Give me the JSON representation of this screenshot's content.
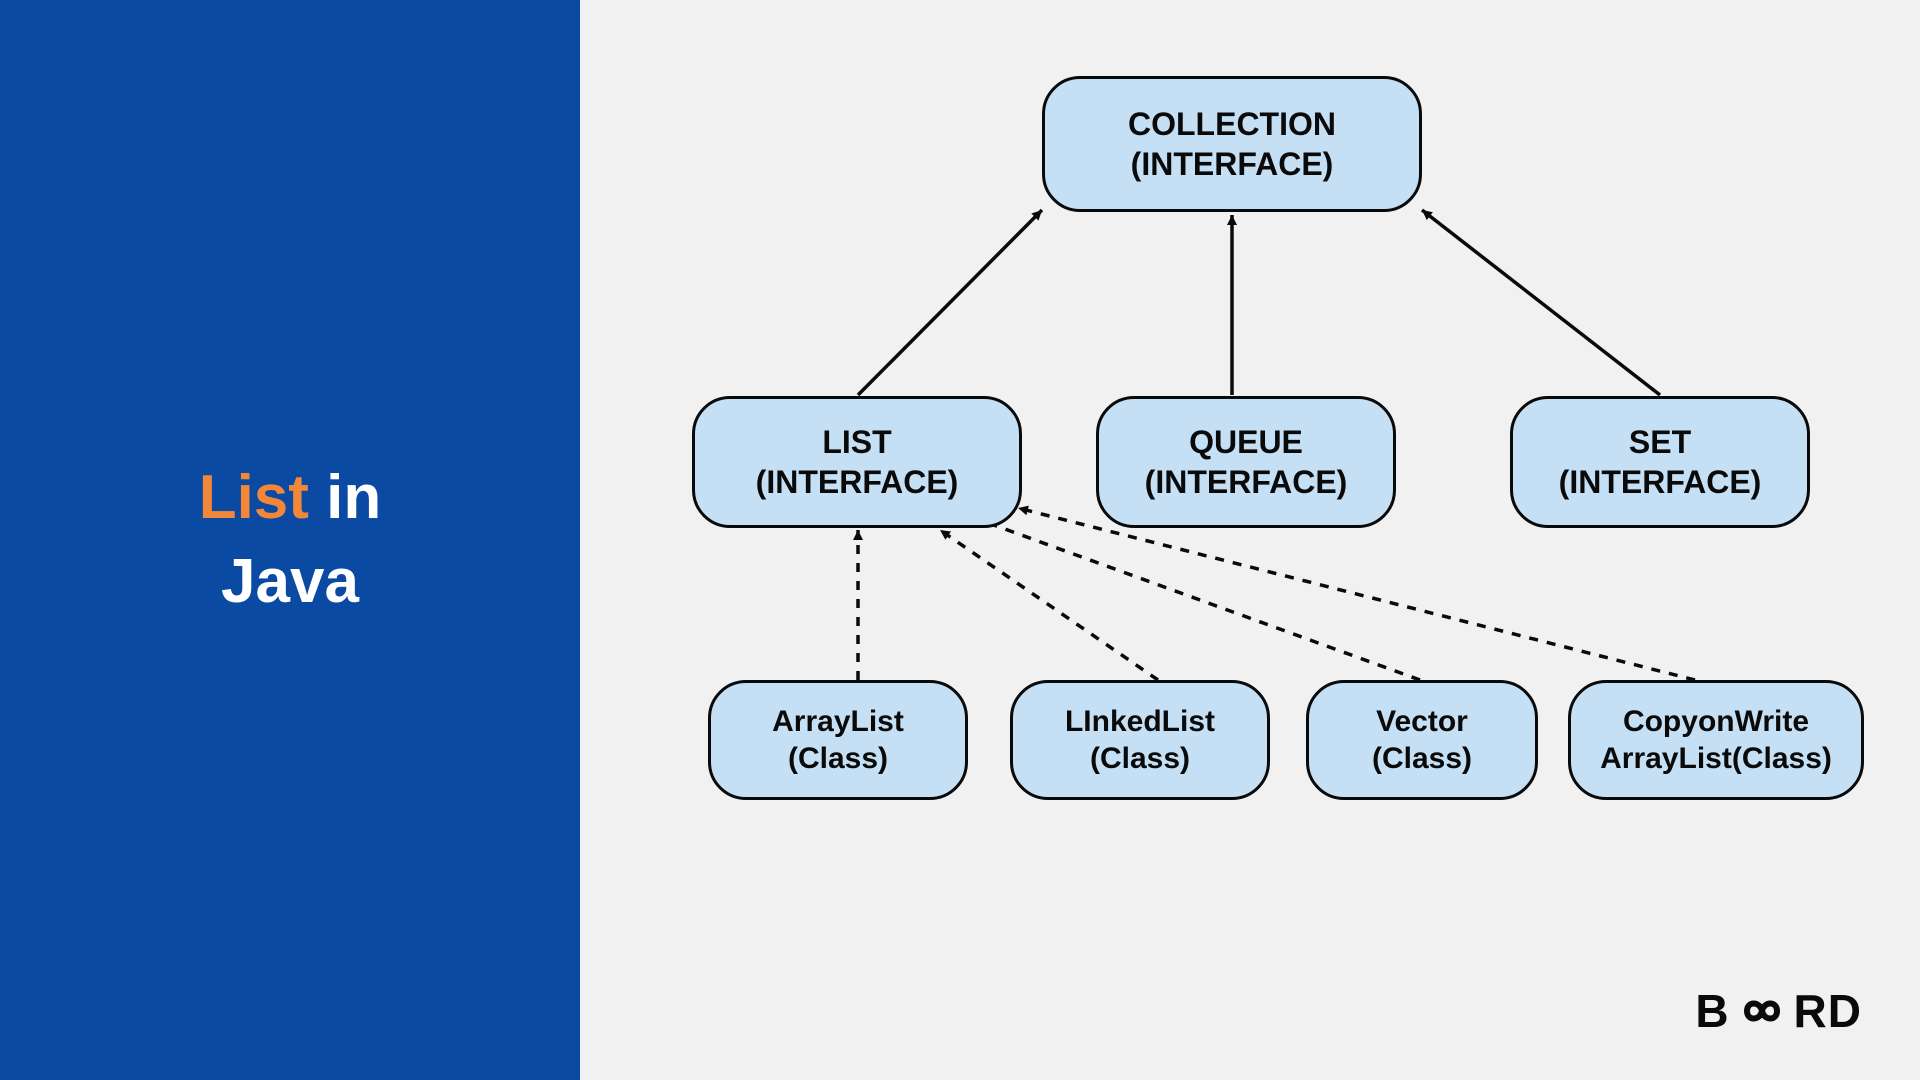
{
  "title": {
    "accent": "List",
    "rest1": "in",
    "rest2": "Java"
  },
  "nodes": {
    "collection": {
      "l1": "COLLECTION",
      "l2": "(INTERFACE)"
    },
    "list": {
      "l1": "LIST",
      "l2": "(INTERFACE)"
    },
    "queue": {
      "l1": "QUEUE",
      "l2": "(INTERFACE)"
    },
    "set": {
      "l1": "SET",
      "l2": "(INTERFACE)"
    },
    "arraylist": {
      "l1": "ArrayList",
      "l2": "(Class)"
    },
    "linkedlist": {
      "l1": "LInkedList",
      "l2": "(Class)"
    },
    "vector": {
      "l1": "Vector",
      "l2": "(Class)"
    },
    "cowal": {
      "l1": "CopyonWrite",
      "l2": "ArrayList(Class)"
    }
  },
  "logo": {
    "b": "B",
    "rd": "RD"
  },
  "colors": {
    "sidebar": "#0a4aa3",
    "accent": "#f2873a",
    "nodeFill": "#c5dff4",
    "stroke": "#0a0a0a"
  }
}
